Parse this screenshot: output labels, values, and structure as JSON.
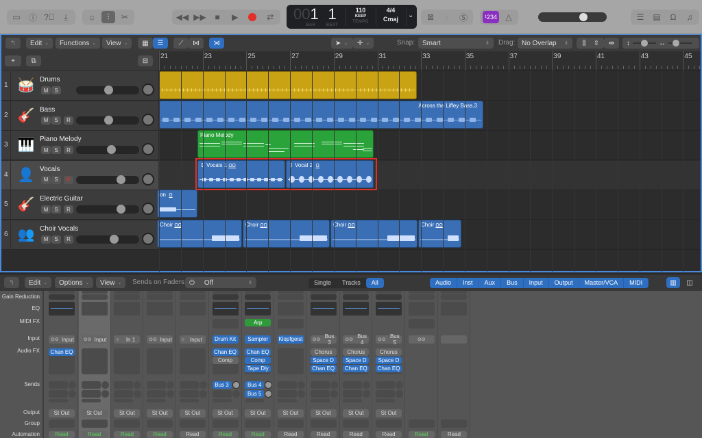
{
  "toolbar": {
    "left_icons": [
      "library-icon",
      "inspector-icon",
      "quick-help-icon",
      "download-icon"
    ],
    "view_icons": [
      "smart-controls-icon",
      "mixer-icon",
      "editors-icon"
    ],
    "transport": [
      "rewind-icon",
      "fast-forward-icon",
      "stop-icon",
      "play-icon",
      "record-icon",
      "cycle-icon"
    ],
    "lcd": {
      "bar_dim": "00",
      "bar": "1",
      "beat": "1",
      "bar_label": "BAR",
      "beat_label": "BEAT",
      "tempo": "110",
      "tempo_mode": "KEEP",
      "tempo_label": "TEMPO",
      "signature": "4/4",
      "key": "Cmaj"
    },
    "mode_icons": [
      "replace-icon",
      "tuner-icon",
      "solo-icon"
    ],
    "count_in": "¹234",
    "metronome_icon": "metronome-icon",
    "master_volume": 0.68,
    "right_icons": [
      "list-editors-icon",
      "note-pad-icon",
      "loop-browser-icon",
      "browser-icon"
    ]
  },
  "arrange_toolbar": {
    "back_icon": "back-icon",
    "menus": [
      "Edit",
      "Functions",
      "View"
    ],
    "snap_label": "Snap:",
    "snap_value": "Smart",
    "drag_label": "Drag:",
    "drag_value": "No Overlap"
  },
  "ruler": {
    "bars": [
      "21",
      "23",
      "25",
      "27",
      "29",
      "31",
      "33",
      "35",
      "37",
      "39",
      "41",
      "43",
      "45"
    ]
  },
  "tracks": [
    {
      "num": "1",
      "name": "Drums",
      "icon": "drum-kit-icon",
      "has_record": false,
      "record_armed": false,
      "volume": 0.5,
      "color": "#c9a314"
    },
    {
      "num": "2",
      "name": "Bass",
      "icon": "bass-guitar-icon",
      "has_record": true,
      "record_armed": false,
      "volume": 0.5,
      "color": "#3a6fb5"
    },
    {
      "num": "3",
      "name": "Piano Melody",
      "icon": "grand-piano-icon",
      "has_record": true,
      "record_armed": false,
      "volume": 0.55,
      "color": "#29a33a"
    },
    {
      "num": "4",
      "name": "Vocals",
      "icon": "vocalist-icon",
      "has_record": true,
      "record_armed": true,
      "volume": 0.72,
      "color": "#3a6fb5"
    },
    {
      "num": "5",
      "name": "Electric Guitar",
      "icon": "electric-guitar-icon",
      "has_record": true,
      "record_armed": false,
      "volume": 0.72,
      "color": "#3a6fb5"
    },
    {
      "num": "6",
      "name": "Choir Vocals",
      "icon": "choir-icon",
      "has_record": true,
      "record_armed": false,
      "volume": 0.6,
      "color": "#3a6fb5"
    }
  ],
  "track_buttons": {
    "mute": "M",
    "solo": "S",
    "record": "R"
  },
  "regions": {
    "bass": "Across the Liffey Bass.3",
    "piano": "Piano Melody",
    "vocals1": "Vocals 1",
    "vocal2": "Vocal 2",
    "guitar": "on",
    "choir": [
      "Choir",
      "Choir",
      "Choir",
      "Choir"
    ]
  },
  "mixer_toolbar": {
    "menus": [
      "Edit",
      "Options",
      "View"
    ],
    "sends_label": "Sends on Faders:",
    "sends_value": "Off",
    "scope": [
      "Single",
      "Tracks",
      "All"
    ],
    "scope_selected": "All",
    "filters": [
      "Audio",
      "Inst",
      "Aux",
      "Bus",
      "Input",
      "Output",
      "Master/VCA",
      "MIDI"
    ]
  },
  "mixer_labels": [
    "Gain Reduction",
    "EQ",
    "MIDI FX",
    "Input",
    "Audio FX",
    "Sends",
    "Output",
    "Group",
    "Automation"
  ],
  "strips": [
    {
      "input": "Input",
      "input_icon": "stereo-link-icon",
      "input_blue": false,
      "fx": [
        "Chan EQ"
      ],
      "fx_blue": [
        true
      ],
      "sends": [],
      "output": "St Out",
      "automation": "Read",
      "auto_green": true,
      "eq": true,
      "midi": ""
    },
    {
      "input": "Input",
      "input_icon": "stereo-link-icon",
      "input_blue": false,
      "fx": [],
      "fx_blue": [],
      "sends": [],
      "output": "St Out",
      "automation": "Read",
      "auto_green": true,
      "eq": false,
      "midi": ""
    },
    {
      "input": "In 1",
      "input_icon": "mono-icon",
      "input_blue": false,
      "fx": [],
      "fx_blue": [],
      "sends": [],
      "output": "St Out",
      "automation": "Read",
      "auto_green": true,
      "eq": false,
      "midi": ""
    },
    {
      "input": "Input",
      "input_icon": "stereo-link-icon",
      "input_blue": false,
      "fx": [],
      "fx_blue": [],
      "sends": [],
      "output": "St Out",
      "automation": "Read",
      "auto_green": true,
      "eq": false,
      "midi": ""
    },
    {
      "input": "Input",
      "input_icon": "mono-icon",
      "input_blue": false,
      "fx": [],
      "fx_blue": [],
      "sends": [],
      "output": "St Out",
      "automation": "Read",
      "auto_green": false,
      "eq": false,
      "midi": ""
    },
    {
      "input": "Drum Kit",
      "input_icon": "",
      "input_blue": true,
      "fx": [
        "Chan EQ",
        "Comp"
      ],
      "fx_blue": [
        true,
        false
      ],
      "sends": [
        "Bus 3"
      ],
      "output": "St Out",
      "automation": "Read",
      "auto_green": true,
      "eq": true,
      "midi": ""
    },
    {
      "input": "Sampler",
      "input_icon": "",
      "input_blue": true,
      "fx": [
        "Chan EQ",
        "Comp",
        "Tape Dly"
      ],
      "fx_blue": [
        true,
        true,
        true
      ],
      "sends": [
        "Bus 4",
        "Bus 5"
      ],
      "output": "St Out",
      "automation": "Read",
      "auto_green": true,
      "eq": true,
      "midi": "Arp"
    },
    {
      "input": "Klopfgeist",
      "input_icon": "",
      "input_blue": true,
      "fx": [],
      "fx_blue": [],
      "sends": [],
      "output": "St Out",
      "automation": "Read",
      "auto_green": false,
      "eq": false,
      "midi": ""
    },
    {
      "input": "Bus 3",
      "input_icon": "stereo-link-icon",
      "input_blue": false,
      "fx": [
        "Chorus",
        "Space D",
        "Chan EQ"
      ],
      "fx_blue": [
        false,
        true,
        true
      ],
      "sends": [],
      "output": "St Out",
      "automation": "Read",
      "auto_green": false,
      "eq": true,
      "midi": ""
    },
    {
      "input": "Bus 4",
      "input_icon": "stereo-link-icon",
      "input_blue": false,
      "fx": [
        "Chorus",
        "Space D",
        "Chan EQ"
      ],
      "fx_blue": [
        false,
        true,
        true
      ],
      "sends": [],
      "output": "St Out",
      "automation": "Read",
      "auto_green": false,
      "eq": true,
      "midi": ""
    },
    {
      "input": "Bus 5",
      "input_icon": "stereo-link-icon",
      "input_blue": false,
      "fx": [
        "Chorus",
        "Space D",
        "Chan EQ"
      ],
      "fx_blue": [
        false,
        true,
        true
      ],
      "sends": [],
      "output": "St Out",
      "automation": "Read",
      "auto_green": false,
      "eq": true,
      "midi": ""
    },
    {
      "input": "",
      "input_icon": "stereo-link-icon",
      "input_blue": false,
      "fx": [],
      "fx_blue": [],
      "sends": [],
      "output": "",
      "automation": "Read",
      "auto_green": true,
      "eq": false,
      "midi": ""
    },
    {
      "input": "",
      "input_icon": "",
      "input_blue": false,
      "fx": [],
      "fx_blue": [],
      "sends": [],
      "output": "",
      "automation": "Read",
      "auto_green": false,
      "eq": false,
      "midi": ""
    }
  ]
}
